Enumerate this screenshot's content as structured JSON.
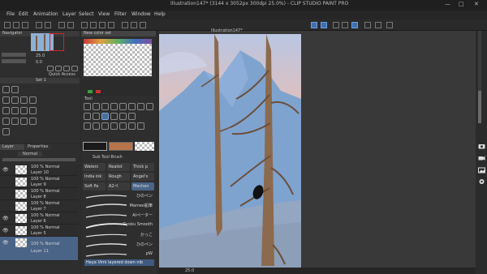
{
  "window": {
    "title": "Illustration147* (3144 x 3052px 300dpi 25.0%) - CLIP STUDIO PAINT PRO",
    "controls": [
      "—",
      "□",
      "✕"
    ]
  },
  "menu": [
    "File",
    "Edit",
    "Animation",
    "Layer",
    "Select",
    "View",
    "Filter",
    "Window",
    "Help"
  ],
  "navigator": {
    "title": "Navigator",
    "zoom": "25.0",
    "rotation": "0.0"
  },
  "subtool_set": {
    "label": "Set 1",
    "quick_access": "Quick Access"
  },
  "color_set": {
    "title": "New color set"
  },
  "tool_panel": {
    "label": "Tool"
  },
  "layers": {
    "tabs": [
      "Layer",
      "Properties"
    ],
    "blend_mode": "Normal",
    "opacity": "100",
    "rows": [
      {
        "mode": "100 % Normal",
        "name": "Layer 10",
        "selected": false,
        "visible": true
      },
      {
        "mode": "100 % Normal",
        "name": "Layer 9",
        "selected": false,
        "visible": false
      },
      {
        "mode": "100 % Normal",
        "name": "Layer 8",
        "selected": false,
        "visible": false
      },
      {
        "mode": "100 % Normal",
        "name": "Layer 7",
        "selected": false,
        "visible": false
      },
      {
        "mode": "100 % Normal",
        "name": "Layer 6",
        "selected": false,
        "visible": true
      },
      {
        "mode": "100 % Normal",
        "name": "Layer 5",
        "selected": false,
        "visible": true
      },
      {
        "mode": "100 % Normal",
        "name": "Layer 11",
        "selected": true,
        "visible": true
      }
    ]
  },
  "brush_panel": {
    "title": "Sub Tool Brush",
    "tabs": [
      "Waterc",
      "Realist",
      "Thick p",
      "India ink",
      "Rough",
      "Angel's",
      "Soft Pa",
      "A2ペ",
      "Mechan"
    ],
    "brushes": [
      "ひのペン",
      "Mameo鉛筆",
      "AIペーター",
      "Gyoku Smooth",
      "かっこ",
      "ひのペン",
      "pW"
    ],
    "tooltip": "Heya Vimi layered down nib"
  },
  "canvas": {
    "tab": "Illustration147*",
    "zoom_status": "25.0"
  },
  "colors": {
    "sky": "#a8c4e4",
    "mountain": "#7fa3cf",
    "ground": "#93a7c2",
    "trunk": "#8b6a4d",
    "main_color": "#1a1a1a",
    "sub_color": "#b7744a",
    "accent": "#4a6487"
  }
}
